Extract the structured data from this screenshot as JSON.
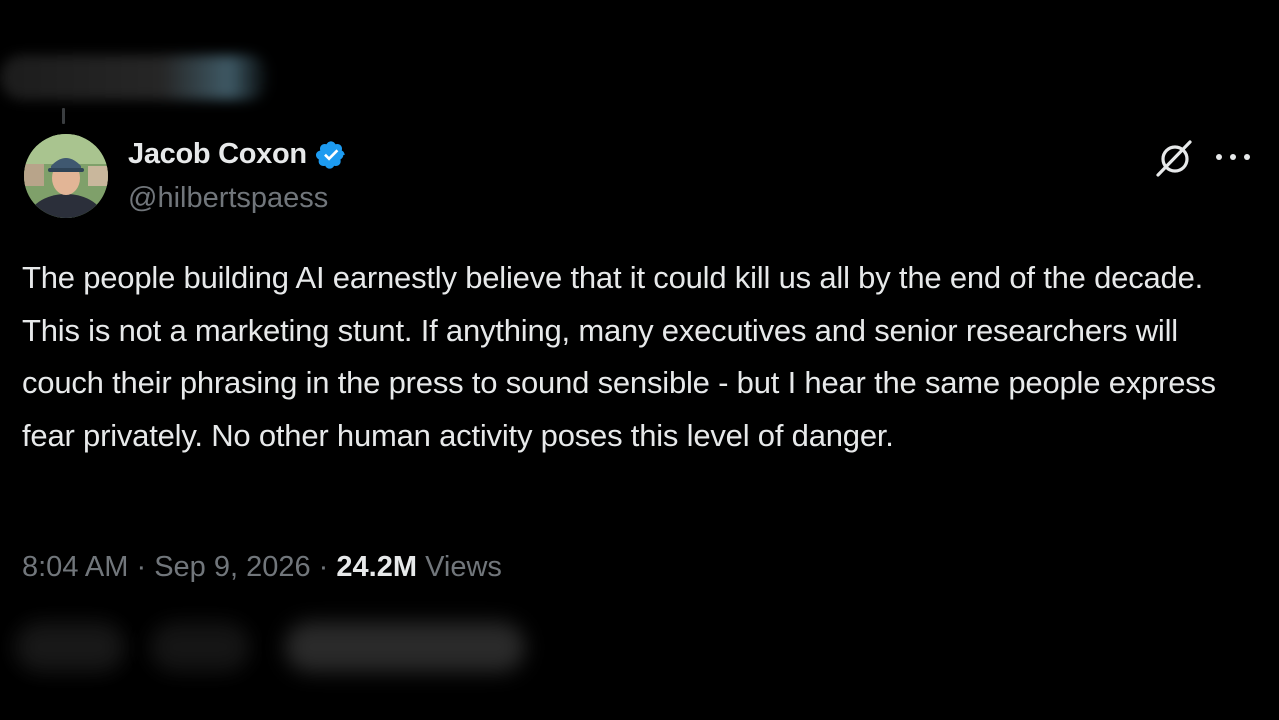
{
  "post": {
    "author": {
      "display_name": "Jacob Coxon",
      "handle": "@hilbertspaess",
      "verified": true
    },
    "text": "The people building AI earnestly believe that it could kill us all by the end of the decade. This is not a marketing stunt. If anything, many executives and senior researchers will couch their phrasing in the press to sound sensible - but I hear the same people express fear privately. No other human activity poses this level of danger.",
    "time": "8:04 AM",
    "date": "Sep 9, 2026",
    "separator": " · ",
    "views_count": "24.2M",
    "views_label": "Views"
  },
  "icons": {
    "verified": "verified-badge-icon",
    "grok": "grok-icon",
    "more": "more-options-icon"
  },
  "colors": {
    "background": "#000000",
    "text_primary": "#e7e9ea",
    "text_secondary": "#71767b",
    "verified_blue": "#1d9bf0"
  }
}
